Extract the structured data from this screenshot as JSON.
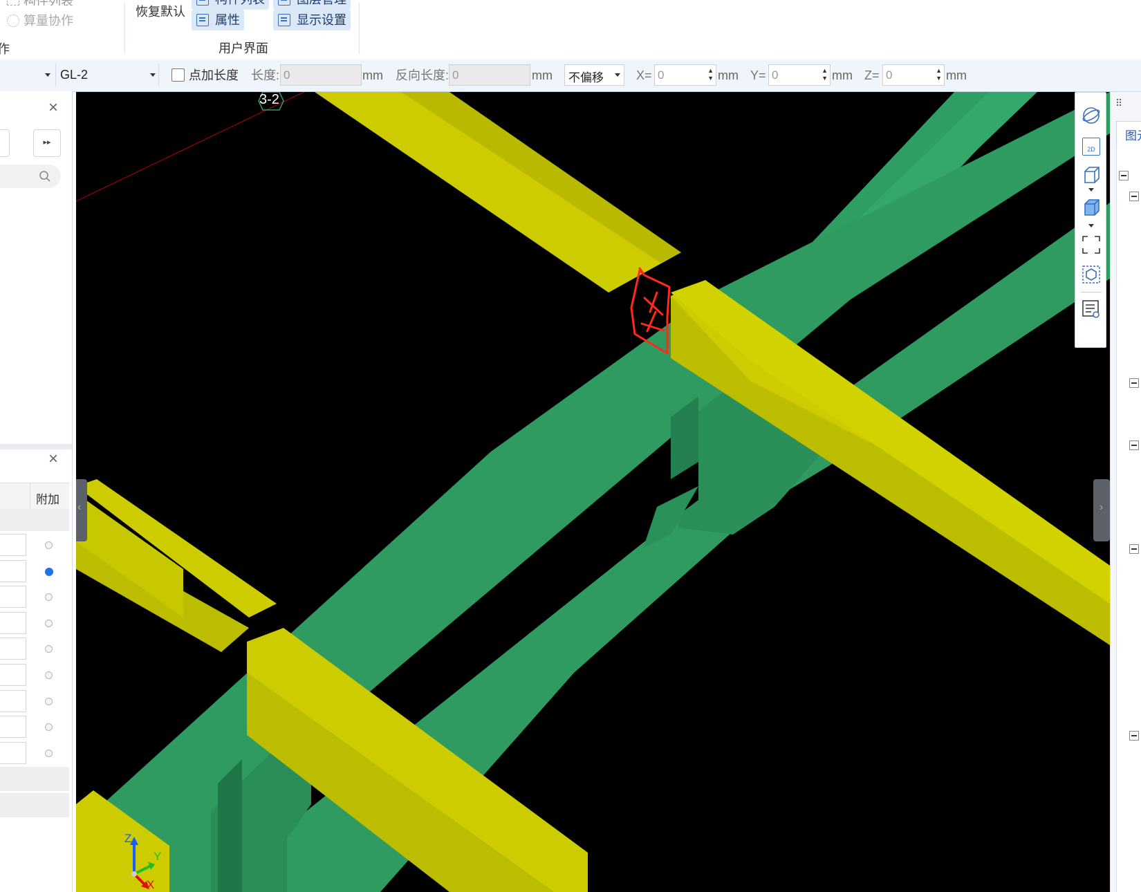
{
  "ribbon": {
    "left_item_1": "构件列表",
    "left_item_2": "算量协作",
    "left_group_label_partial": "作",
    "restore_default": "恢复默认",
    "btn_properties": "属性",
    "btn_display_settings": "显示设置",
    "btn_top_left_partial": "构件列表",
    "btn_top_right_partial": "图层管理",
    "group_label": "用户界面"
  },
  "toolbar": {
    "component_select": "GL-2",
    "checkbox_label": "点加长度",
    "checkbox_checked": false,
    "length_label": "长度:",
    "length_value": "0",
    "unit_mm": "mm",
    "reverse_length_label": "反向长度:",
    "reverse_length_value": "0",
    "offset_select": "不偏移",
    "x_label": "X=",
    "x_value": "0",
    "y_label": "Y=",
    "y_value": "0",
    "z_label": "Z=",
    "z_value": "0"
  },
  "left_panel": {
    "column_header": "附加",
    "radio_states": [
      false,
      true,
      false,
      false,
      false,
      false,
      false,
      false,
      false
    ]
  },
  "viewport": {
    "axis_marker": "3-2",
    "axes": {
      "x": "X",
      "y": "Y",
      "z": "Z"
    },
    "colors": {
      "background": "#000000",
      "beam_yellow": "#c8c800",
      "beam_green": "#2e9e62",
      "annotation": "#ff2a1a"
    }
  },
  "right_toolbar": {
    "icons": [
      "orbit-icon",
      "view-2d-icon",
      "cube-wire-icon",
      "cube-solid-icon",
      "zoom-extent-icon",
      "box-select-icon",
      "display-settings-icon"
    ],
    "view_2d_text": "2D"
  },
  "right_panel": {
    "tab_label_partial": "图元"
  }
}
